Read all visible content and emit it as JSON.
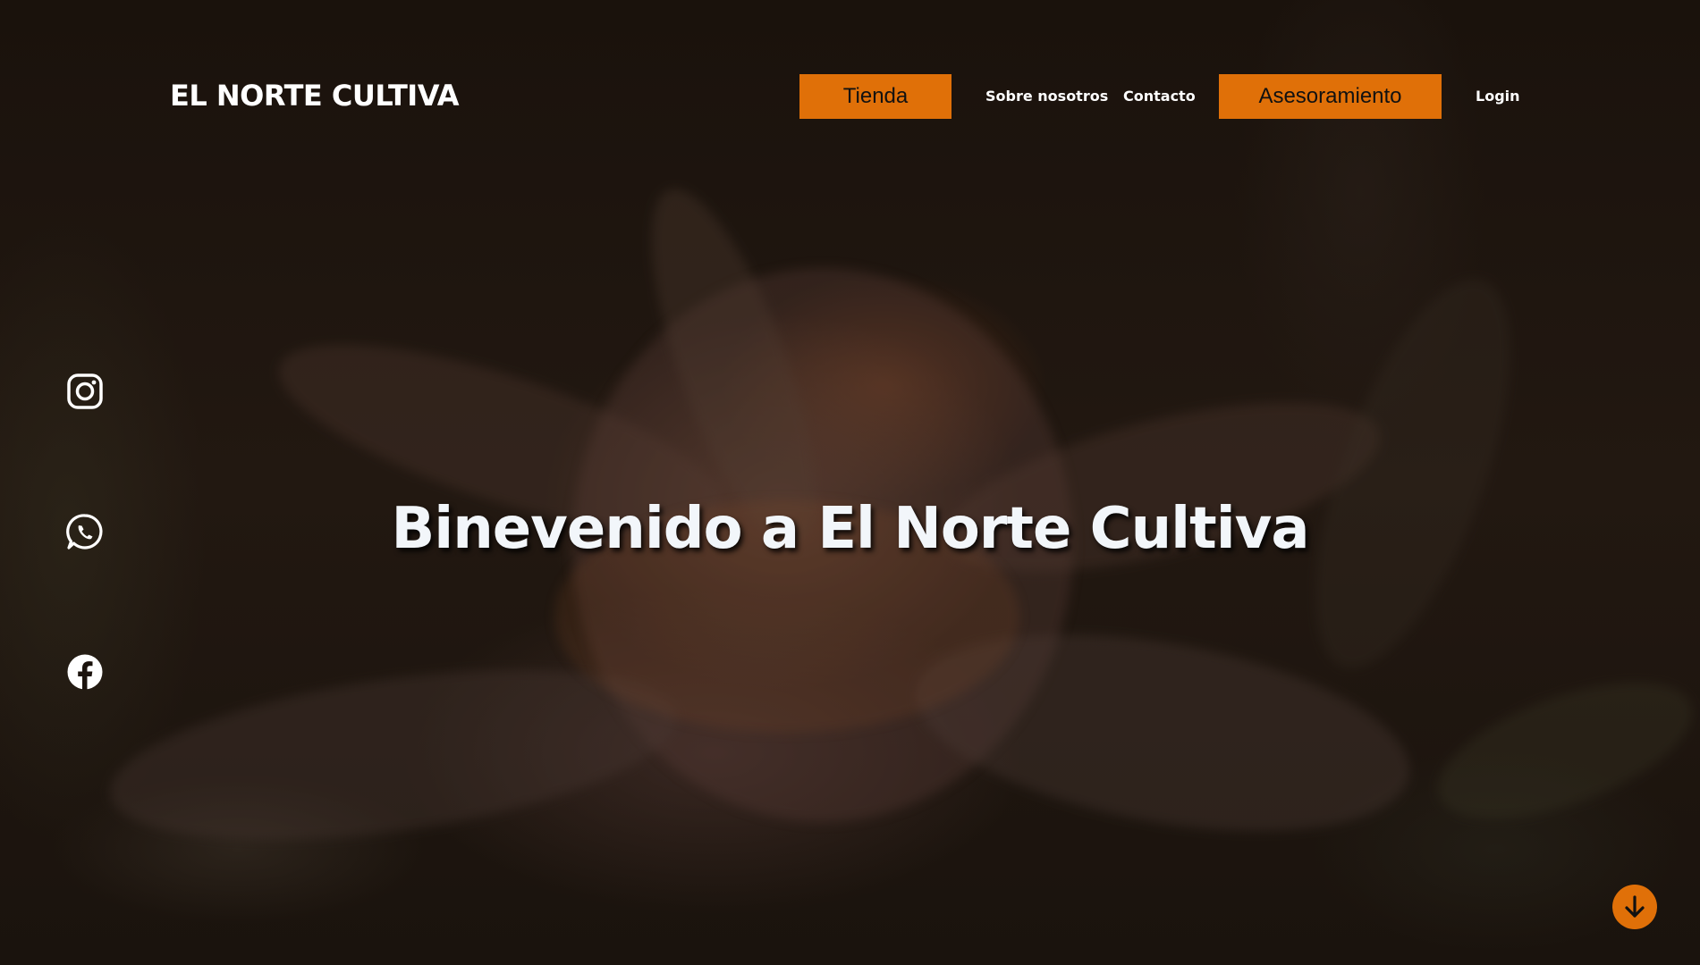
{
  "header": {
    "logo": "EL NORTE CULTIVA",
    "nav": {
      "tienda": "Tienda",
      "sobre_nosotros": "Sobre nosotros",
      "contacto": "Contacto",
      "asesoramiento": "Asesoramiento",
      "login": "Login"
    }
  },
  "social": [
    "instagram-icon",
    "whatsapp-icon",
    "facebook-icon"
  ],
  "hero": {
    "headline": "Binevenido a El Norte Cultiva"
  },
  "scroll_button": {
    "icon": "arrow-down-icon"
  },
  "colors": {
    "accent": "#e07008",
    "headline_text": "#f2f6fa"
  }
}
